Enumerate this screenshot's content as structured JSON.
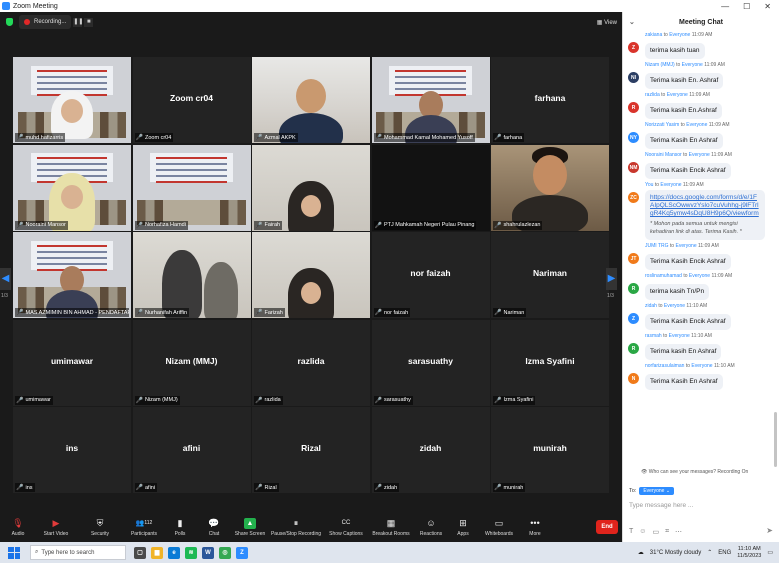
{
  "window": {
    "title": "Zoom Meeting",
    "min": "—",
    "max": "☐",
    "close": "✕"
  },
  "topbar": {
    "recording": "Recording...",
    "pause": "❚❚",
    "stop": "■",
    "view": "View"
  },
  "pagination": {
    "left": "1/3",
    "right": "1/3",
    "prev": "◀",
    "next": "▶"
  },
  "tiles": [
    {
      "name": "muhd hafizarris",
      "kind": "poster",
      "active": true
    },
    {
      "name": "Zoom cr04",
      "big": "Zoom cr04"
    },
    {
      "name": "Azmal AKPK",
      "kind": "man-room"
    },
    {
      "name": "Mohammad Kamal Mohamed Yusoff",
      "kind": "poster-man"
    },
    {
      "name": "farhana",
      "big": "farhana"
    },
    {
      "name": "Nooraini Mansor",
      "kind": "poster-hijab"
    },
    {
      "name": "Norhafiza Hamdi",
      "kind": "poster"
    },
    {
      "name": "Fairah",
      "kind": "hijab-room"
    },
    {
      "name": "PTJ Mahkamah Negeri Pulau Pinang",
      "kind": "dark"
    },
    {
      "name": "shahrulazlezan",
      "kind": "man-warm"
    },
    {
      "name": "MAS AZMIMIN BIN AHMAD - PENDAFTARAN",
      "kind": "poster-man"
    },
    {
      "name": "Nurhanifah Ariffin",
      "kind": "two-hijab"
    },
    {
      "name": "Farizah",
      "kind": "hijab-room"
    },
    {
      "name": "nor faizah",
      "big": "nor faizah"
    },
    {
      "name": "Nariman",
      "big": "Nariman"
    },
    {
      "name": "umimawar",
      "big": "umimawar"
    },
    {
      "name": "Nizam (MMJ)",
      "big": "Nizam (MMJ)"
    },
    {
      "name": "razlida",
      "big": "razlida"
    },
    {
      "name": "sarasuathy",
      "big": "sarasuathy"
    },
    {
      "name": "Izma Syafini",
      "big": "Izma Syafini"
    },
    {
      "name": "ins",
      "big": "ins"
    },
    {
      "name": "afini",
      "big": "afini"
    },
    {
      "name": "Rizal",
      "big": "Rizal"
    },
    {
      "name": "zidah",
      "big": "zidah"
    },
    {
      "name": "munirah",
      "big": "munirah"
    }
  ],
  "toolbar": {
    "audio": "Audio",
    "video": "Start Video",
    "security": "Security",
    "participants": "Participants",
    "participants_count": "112",
    "polls": "Polls",
    "chat": "Chat",
    "share": "Share Screen",
    "record": "Pause/Stop Recording",
    "captions": "Show Captions",
    "breakout": "Breakout Rooms",
    "reactions": "Reactions",
    "apps": "Apps",
    "whiteboards": "Whiteboards",
    "more": "More",
    "end": "End"
  },
  "chat": {
    "title": "Meeting Chat",
    "messages": [
      {
        "initials": "Z",
        "color": "#d9342b",
        "sender": "zakiana",
        "to": "to",
        "target": "Everyone",
        "time": "11:09 AM",
        "text": "terima kasih tuan"
      },
      {
        "initials": "NI",
        "color": "#2b3e63",
        "sender": "Nizam (MMJ)",
        "to": "to",
        "target": "Everyone",
        "time": "11:09 AM",
        "text": "Terima kasih En. Ashraf"
      },
      {
        "initials": "R",
        "color": "#d9342b",
        "sender": "razlida",
        "to": "to",
        "target": "Everyone",
        "time": "11:09 AM",
        "text": "Terima kasih En.Ashraf"
      },
      {
        "initials": "NY",
        "color": "#2d8cff",
        "sender": "Norizzati Yasim",
        "to": "to",
        "target": "Everyone",
        "time": "11:09 AM",
        "text": "Terima Kasih En Ashraf"
      },
      {
        "initials": "NM",
        "color": "#c8372d",
        "sender": "Nooraini Mansor",
        "to": "to",
        "target": "Everyone",
        "time": "11:09 AM",
        "text": "Terima Kasih Encik Ashraf"
      },
      {
        "initials": "ZC",
        "color": "#f07a1a",
        "sender": "You",
        "to": "to",
        "target": "Everyone",
        "time": "11:09 AM",
        "link": "https://docs.google.com/forms/d/e/1FAIpQLScOwwvzYslo7cuVuhhg-j9lFTrlgR4Kq5ymw4sDqU8H9p6Q/viewform",
        "note": "* Mohon pada semua untuk mengisi kehadiran link di atas. Terima Kasih. *"
      },
      {
        "initials": "JT",
        "color": "#f07a1a",
        "sender": "JUMI TRG",
        "to": "to",
        "target": "Everyone",
        "time": "11:09 AM",
        "text": "Terima Kasih Encik Ashraf"
      },
      {
        "initials": "R",
        "color": "#2aa745",
        "sender": "roslinamuhamad",
        "to": "to",
        "target": "Everyone",
        "time": "11:09 AM",
        "text": "terima kasih Tn/Pn"
      },
      {
        "initials": "Z",
        "color": "#2d8cff",
        "sender": "zidah",
        "to": "to",
        "target": "Everyone",
        "time": "11:10 AM",
        "text": "Terima Kasih Encik Ashraf"
      },
      {
        "initials": "R",
        "color": "#2aa745",
        "sender": "rasmah",
        "to": "to",
        "target": "Everyone",
        "time": "11:10 AM",
        "text": "Terima kasih En Ashraf"
      },
      {
        "initials": "N",
        "color": "#f07a1a",
        "sender": "norfarizasulaiman",
        "to": "to",
        "target": "Everyone",
        "time": "11:10 AM",
        "text": "Terima Kasih  En Ashraf"
      }
    ],
    "who_can_see": "Who can see your messages? Recording On",
    "to_label": "To:",
    "recipient": "Everyone ⌄",
    "placeholder": "Type message here ..."
  },
  "taskbar": {
    "search_placeholder": "Type here to search",
    "weather": "31°C  Mostly cloudy",
    "lang": "ENG",
    "time": "11:10 AM",
    "date": "11/5/2023"
  }
}
